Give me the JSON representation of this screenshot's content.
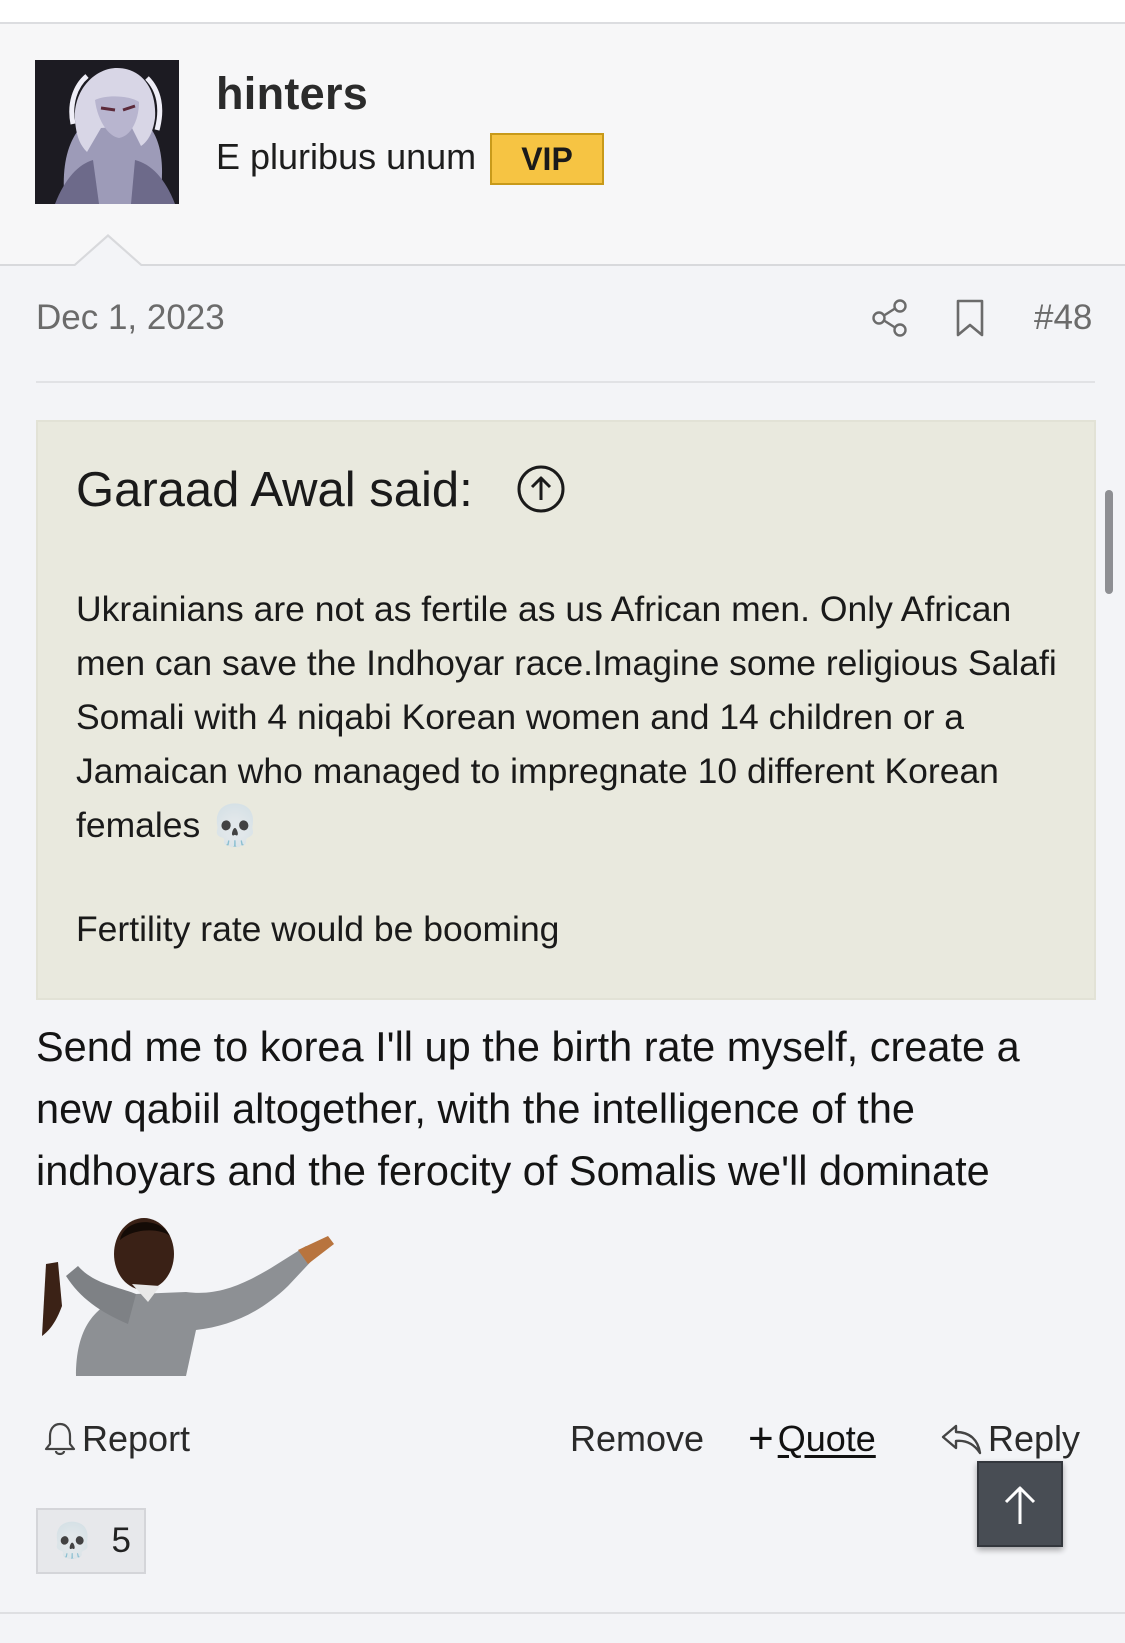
{
  "author": {
    "username": "hinters",
    "user_title": "E pluribus unum",
    "badge": "VIP",
    "badge_color": "#f6c443"
  },
  "post": {
    "date": "Dec 1, 2023",
    "number": "#48",
    "icons": [
      "share-icon",
      "bookmark-icon"
    ],
    "quote": {
      "author_line": "Garaad Awal said:",
      "text_1": "Ukrainians are not as fertile as us African men. Only African men can save the Indhoyar race.Imagine some religious Salafi Somali with 4 niqabi Korean women and 14 children or a Jamaican who managed to impregnate 10 different Korean females",
      "emoji": "💀",
      "text_2": "Fertility rate would be booming",
      "background": "#e9e9de"
    },
    "message": "Send me to korea I'll up the birth rate myself, create a new qabiil altogether, with the intelligence of the indhoyars and the ferocity of Somalis we'll dominate"
  },
  "actions": {
    "report": "Report",
    "remove": "Remove",
    "quote_plus": "+",
    "quote": "Quote",
    "reply": "Reply"
  },
  "reactions": {
    "emoji": "💀",
    "count": "5"
  }
}
